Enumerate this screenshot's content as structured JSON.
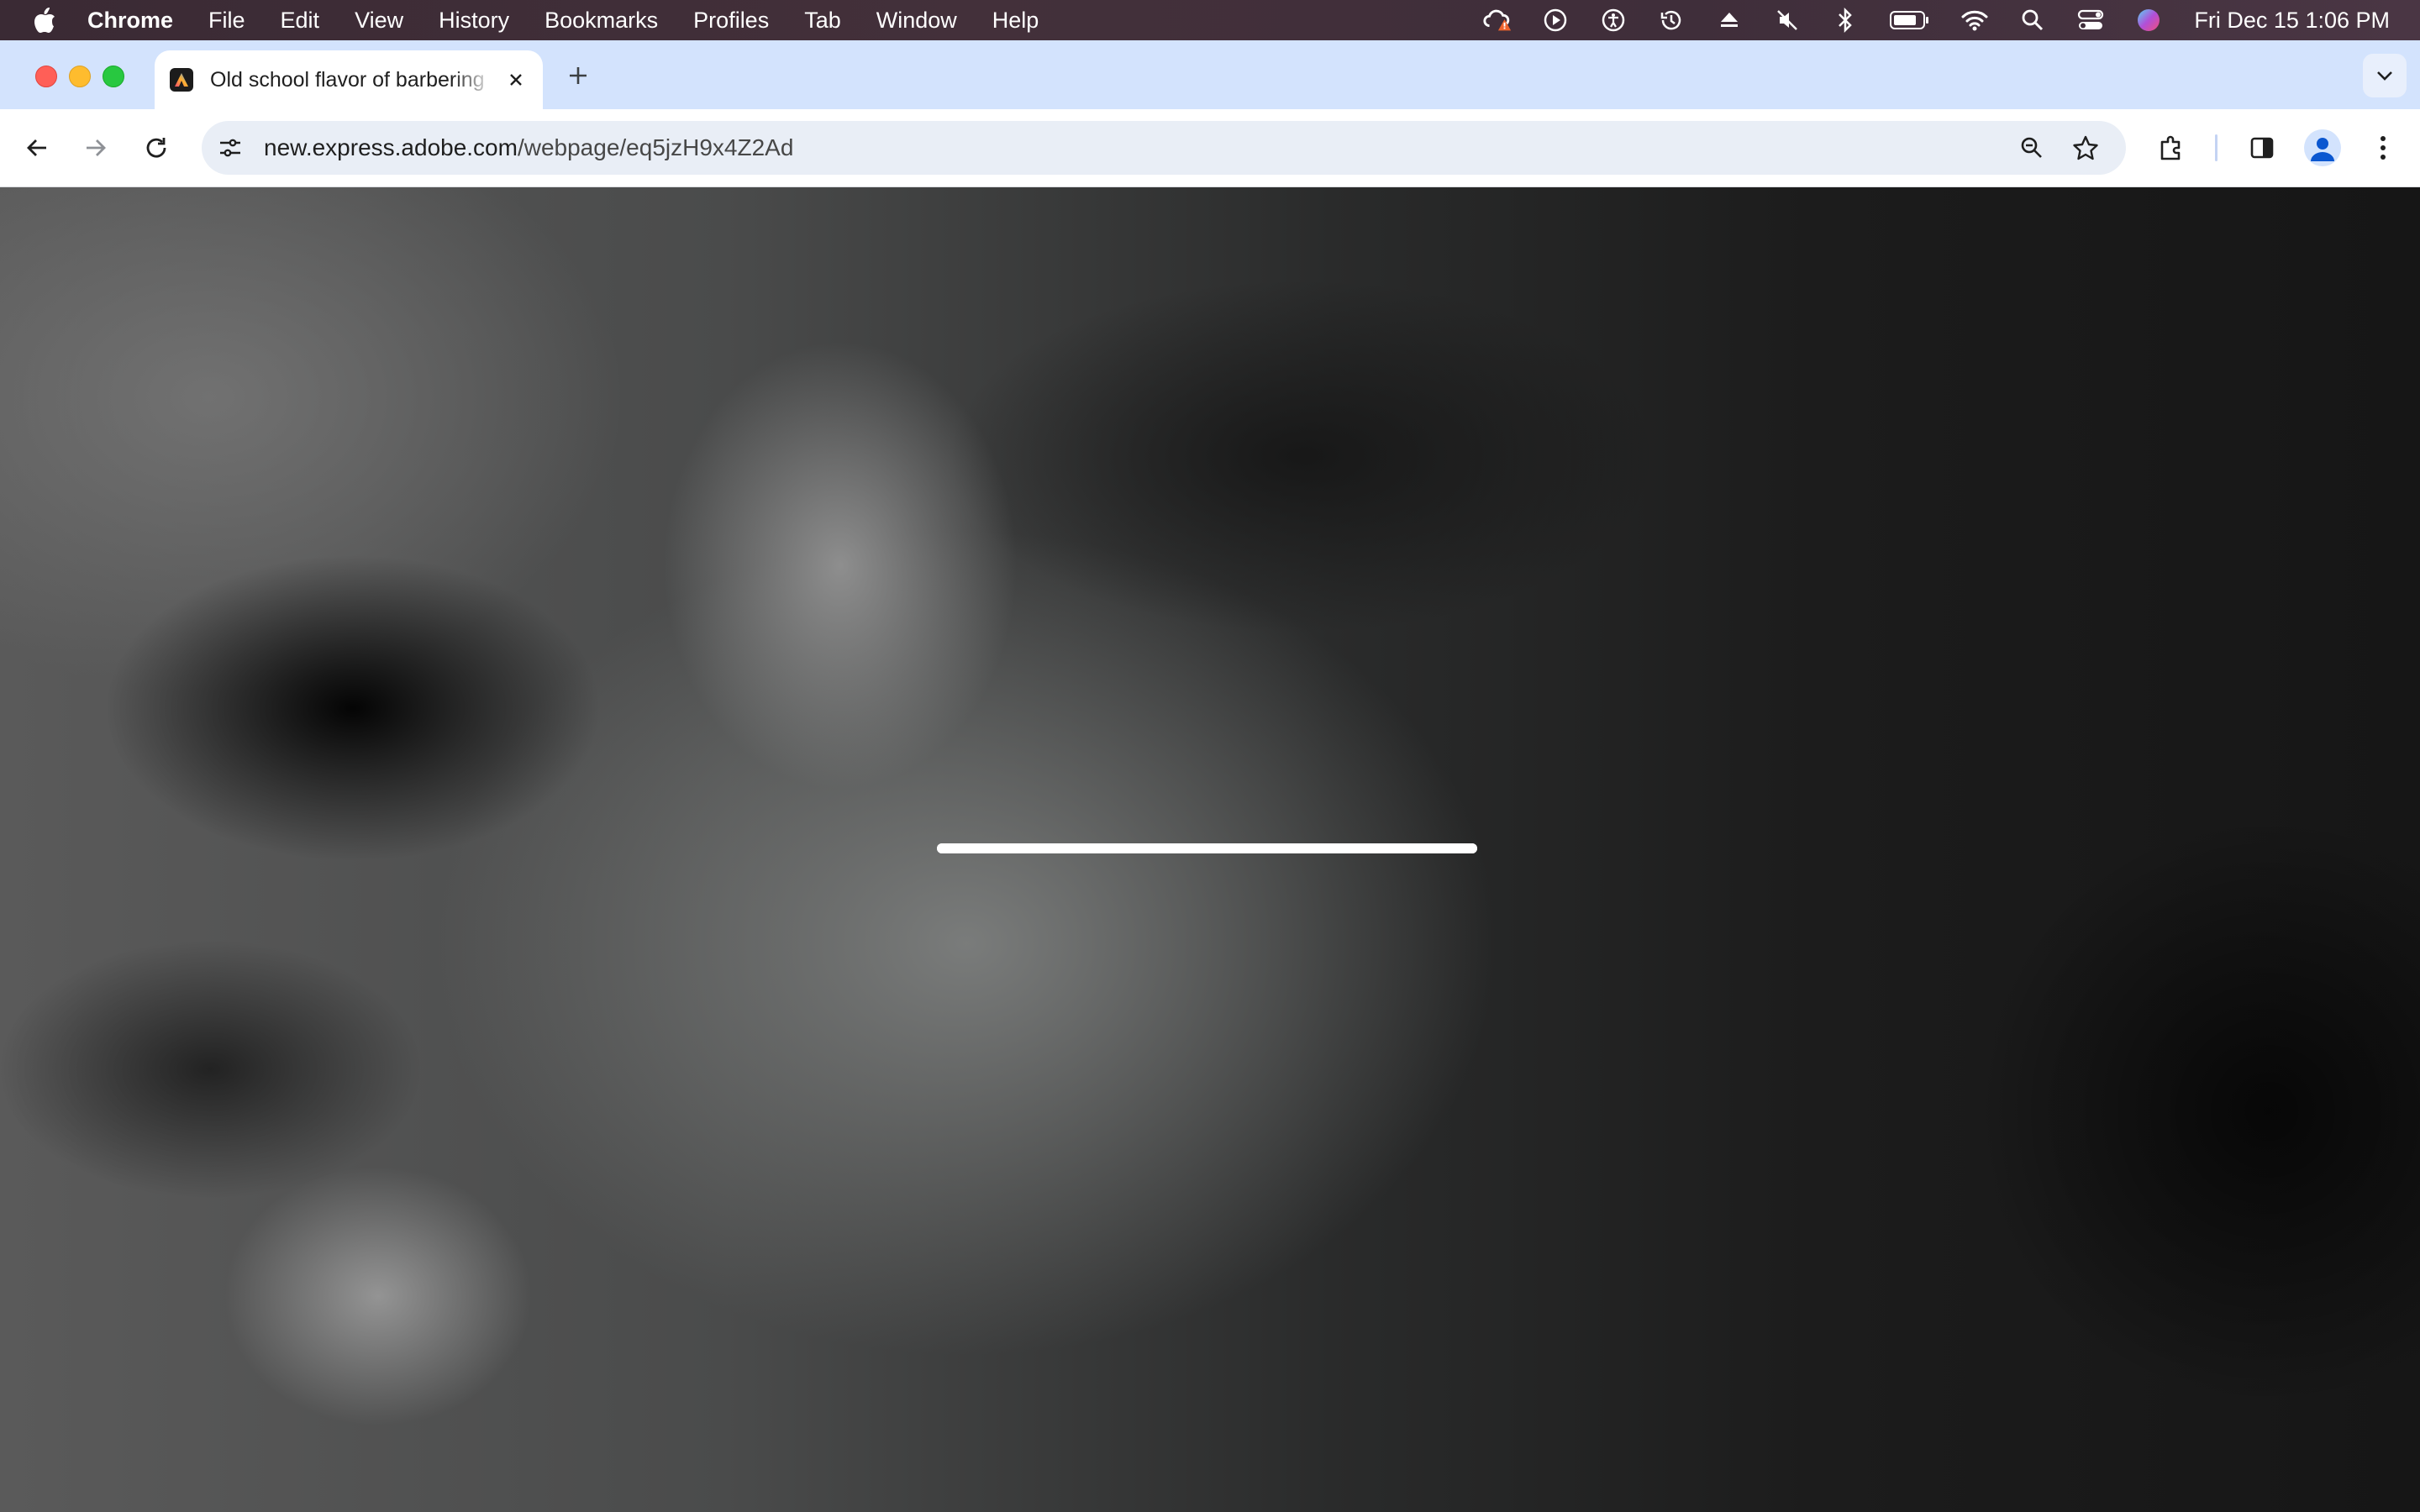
{
  "menubar": {
    "app_name": "Chrome",
    "items": [
      "File",
      "Edit",
      "View",
      "History",
      "Bookmarks",
      "Profiles",
      "Tab",
      "Window",
      "Help"
    ],
    "clock": "Fri Dec 15  1:06 PM"
  },
  "tab": {
    "title": "Old school flavor of barbering"
  },
  "toolbar": {
    "url_host": "new.express.adobe.com",
    "url_path": "/webpage/eq5jzH9x4Z2Ad"
  },
  "page": {
    "loading_progress": 1.0
  },
  "colors": {
    "tabstrip": "#d3e3fd",
    "omnibox": "#e9eef6",
    "close_red": "#ff5f57",
    "minimize_yellow": "#febc2e",
    "maximize_green": "#28c840",
    "avatar_blue": "#0b57d0"
  },
  "icons": {
    "menubar": [
      "apple-icon"
    ],
    "status": [
      "creative-cloud-icon",
      "play-icon",
      "accessibility-icon",
      "time-machine-icon",
      "eject-icon",
      "mute-icon",
      "bluetooth-icon",
      "battery-icon",
      "wifi-icon",
      "spotlight-icon",
      "control-center-icon",
      "siri-icon"
    ],
    "toolbar": [
      "back-icon",
      "forward-icon",
      "reload-icon",
      "site-info-icon",
      "zoom-icon",
      "bookmark-star-icon",
      "extensions-icon",
      "side-panel-icon",
      "profile-icon",
      "menu-icon"
    ]
  }
}
